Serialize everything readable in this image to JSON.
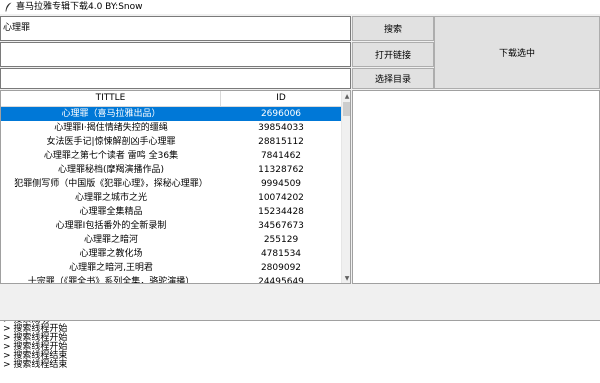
{
  "window": {
    "title": "喜马拉雅专辑下载4.0 BY:Snow",
    "icon": "feather-icon"
  },
  "inputs": {
    "search_value": "心理罪",
    "field2_value": "",
    "field3_value": ""
  },
  "buttons": {
    "search": "搜索",
    "open_link": "打开链接",
    "select_dir": "选择目录",
    "download_selected": "下载选中"
  },
  "table": {
    "columns": [
      "TITTLE",
      "ID"
    ],
    "rows": [
      {
        "title": "心理罪（喜马拉雅出品）",
        "id": "2696006",
        "selected": true
      },
      {
        "title": "心理罪Ⅰ·揭住情绪失控的缰绳",
        "id": "39854033"
      },
      {
        "title": "女法医手记|惊悚解剖凶手心理罪",
        "id": "28815112"
      },
      {
        "title": "心理罪之第七个读者 雷鸣 全36集",
        "id": "7841462"
      },
      {
        "title": "心理罪秘档(摩羯演播作品)",
        "id": "11328762"
      },
      {
        "title": "犯罪侧写师（中国版《犯罪心理》，探秘心理罪）",
        "id": "9994509"
      },
      {
        "title": "心理罪之城市之光",
        "id": "10074202"
      },
      {
        "title": "心理罪全集精品",
        "id": "15234428"
      },
      {
        "title": "心理罪Ⅰ包括番外的全新录制",
        "id": "34567673"
      },
      {
        "title": "心理罪之暗河",
        "id": "255129"
      },
      {
        "title": "心理罪之教化场",
        "id": "4781534"
      },
      {
        "title": "心理罪之暗河,王明君",
        "id": "2809092"
      },
      {
        "title": "十宗罪（《罪全书》系列全集，骆驼演播）",
        "id": "24495649"
      }
    ]
  },
  "log": {
    "lines": [
      "> 搜索成功",
      "> 搜索线程开始",
      "> 搜索线程开始",
      "> 搜索线程开始",
      "> 搜索线程结束",
      "> 搜索线程结束"
    ]
  },
  "colors": {
    "selection": "#0078d7",
    "button_bg": "#e1e1e1",
    "window_bg": "#f0f0f0"
  }
}
